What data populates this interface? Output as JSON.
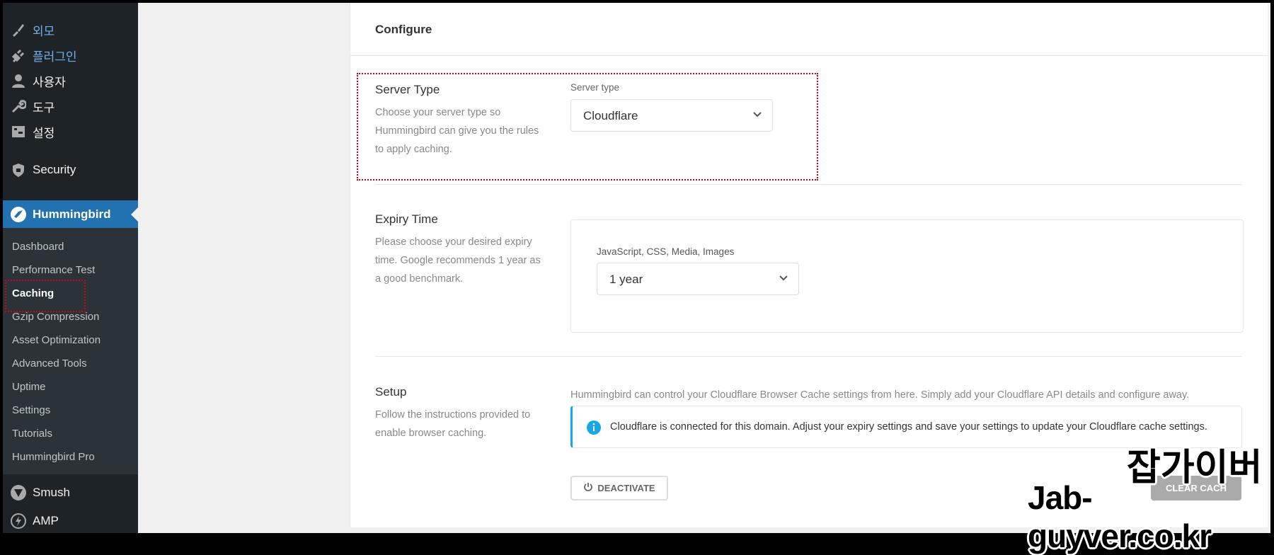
{
  "sidebar": {
    "top_items": [
      {
        "label": "외모",
        "icon": "paintbrush-icon"
      },
      {
        "label": "플러그인",
        "icon": "plugin-icon"
      },
      {
        "label": "사용자",
        "icon": "user-icon"
      },
      {
        "label": "도구",
        "icon": "wrench-icon"
      },
      {
        "label": "설정",
        "icon": "settings-icon"
      }
    ],
    "security": {
      "label": "Security",
      "icon": "shield-icon"
    },
    "hummingbird": {
      "label": "Hummingbird",
      "icon": "hummingbird-icon"
    },
    "submenu": [
      "Dashboard",
      "Performance Test",
      "Caching",
      "Gzip Compression",
      "Asset Optimization",
      "Advanced Tools",
      "Uptime",
      "Settings",
      "Tutorials",
      "Hummingbird Pro"
    ],
    "current_submenu": "Caching",
    "smush": {
      "label": "Smush",
      "icon": "smush-icon"
    },
    "amp": {
      "label": "AMP",
      "icon": "amp-icon"
    }
  },
  "panel": {
    "title": "Configure",
    "server_type": {
      "title": "Server Type",
      "description": "Choose your server type so Hummingbird can give you the rules to apply caching.",
      "field_label": "Server type",
      "selected": "Cloudflare"
    },
    "expiry": {
      "title": "Expiry Time",
      "description": "Please choose your desired expiry time. Google recommends 1 year as a good benchmark.",
      "field_label": "JavaScript, CSS, Media, Images",
      "selected": "1 year"
    },
    "setup": {
      "title": "Setup",
      "description": "Follow the instructions provided to enable browser caching.",
      "intro": "Hummingbird can control your Cloudflare Browser Cache settings from here. Simply add your Cloudflare API details and configure away.",
      "notice": "Cloudflare is connected for this domain. Adjust your expiry settings and save your settings to update your Cloudflare cache settings.",
      "deactivate_label": "DEACTIVATE",
      "clear_cache_label": "CLEAR CACH"
    }
  },
  "watermark": {
    "korean": "잡가이버",
    "url": "Jab-guyver.co.kr"
  },
  "colors": {
    "sidebar_bg": "#1d2327",
    "active_bg": "#2271b1",
    "highlight_border": "#d0021b",
    "notice_accent": "#17a8e3"
  }
}
